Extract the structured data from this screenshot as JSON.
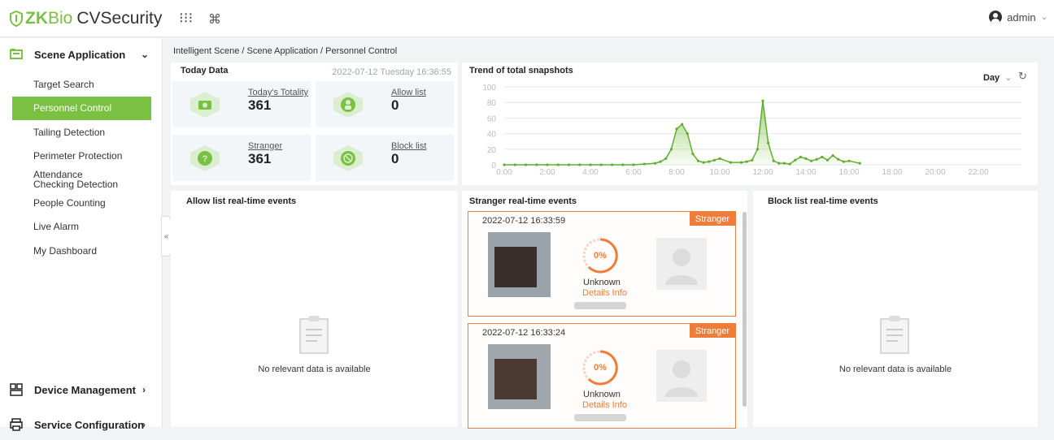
{
  "app": {
    "brand_zk": "ZK",
    "brand_bio": "Bio",
    "brand_cv": "CVSecurity",
    "accent": "#7ac143",
    "warn": "#f07c3a"
  },
  "topbar": {
    "user": "admin"
  },
  "sidebar": {
    "section": "Scene Application",
    "items": [
      "Target Search",
      "Personnel Control",
      "Tailing Detection",
      "Perimeter Protection",
      "Attendance Checking Detection",
      "People Counting",
      "Live Alarm",
      "My Dashboard"
    ],
    "active_index": 1,
    "bottom": [
      "Device Management",
      "Service Configuration"
    ]
  },
  "breadcrumb": "Intelligent Scene / Scene Application / Personnel Control",
  "today": {
    "title": "Today Data",
    "datetime": "2022-07-12 Tuesday 16:36:55",
    "cards": [
      {
        "label": "Today's Totality",
        "value": "361",
        "icon": "camera-icon"
      },
      {
        "label": "Allow list",
        "value": "0",
        "icon": "allow-person-icon"
      },
      {
        "label": "Stranger",
        "value": "361",
        "icon": "stranger-icon"
      },
      {
        "label": "Block list",
        "value": "0",
        "icon": "block-person-icon"
      }
    ]
  },
  "trend": {
    "title": "Trend of total snapshots",
    "period": "Day"
  },
  "chart_data": {
    "type": "area",
    "title": "Trend of total snapshots",
    "xlabel": "",
    "ylabel": "",
    "ylim": [
      0,
      100
    ],
    "y_ticks": [
      "0",
      "20",
      "40",
      "60",
      "80",
      "100"
    ],
    "x_ticks": [
      "0:00",
      "2:00",
      "4:00",
      "6:00",
      "8:00",
      "10:00",
      "12:00",
      "14:00",
      "16:00",
      "18:00",
      "20:00",
      "22:00"
    ],
    "x": [
      0,
      0.5,
      1,
      1.5,
      2,
      2.5,
      3,
      3.5,
      4,
      4.5,
      5,
      5.5,
      6,
      6.5,
      7,
      7.25,
      7.5,
      7.75,
      8,
      8.25,
      8.5,
      8.75,
      9,
      9.25,
      9.5,
      9.75,
      10,
      10.5,
      11,
      11.25,
      11.5,
      11.75,
      12,
      12.25,
      12.5,
      12.75,
      13,
      13.25,
      13.5,
      13.75,
      14,
      14.25,
      14.5,
      14.75,
      15,
      15.25,
      15.5,
      15.75,
      16,
      16.5
    ],
    "values": [
      0,
      0,
      0,
      0,
      0,
      0,
      0,
      0,
      0,
      0,
      0,
      0,
      0,
      1,
      2,
      4,
      8,
      20,
      46,
      52,
      40,
      14,
      5,
      3,
      4,
      6,
      8,
      3,
      3,
      4,
      6,
      20,
      82,
      28,
      5,
      2,
      2,
      1,
      6,
      10,
      8,
      5,
      7,
      10,
      6,
      12,
      7,
      4,
      5,
      2
    ]
  },
  "allow_panel": {
    "title": "Allow list real-time events",
    "empty": "No relevant data is available"
  },
  "stranger_panel": {
    "title": "Stranger real-time events",
    "events": [
      {
        "time": "2022-07-12 16:33:59",
        "badge": "Stranger",
        "percent": "0%",
        "name": "Unknown",
        "link": "Details Info"
      },
      {
        "time": "2022-07-12 16:33:24",
        "badge": "Stranger",
        "percent": "0%",
        "name": "Unknown",
        "link": "Details Info"
      }
    ]
  },
  "block_panel": {
    "title": "Block list real-time events",
    "empty": "No relevant data is available"
  }
}
